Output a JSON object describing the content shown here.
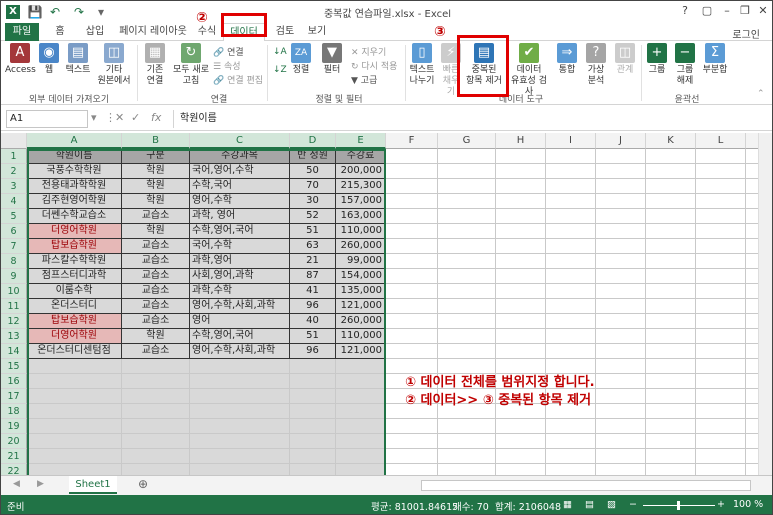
{
  "window": {
    "title": "중복값 연습파일.xlsx - Excel",
    "help": "?",
    "login": "로그인"
  },
  "tabs": [
    "파일",
    "홈",
    "삽입",
    "페이지 레이아웃",
    "수식",
    "데이터",
    "검토",
    "보기"
  ],
  "active_tab": "데이터",
  "ribbon": {
    "ext_group": {
      "label": "외부 데이터 가져오기",
      "buttons": [
        "Access",
        "웹",
        "텍스트",
        "기타",
        "원본에서"
      ]
    },
    "conn_group": {
      "label": "연결",
      "existing": [
        "기존",
        "연결"
      ],
      "refresh_all": [
        "모두 새로",
        "고침"
      ],
      "small": [
        "연결",
        "속성",
        "연결 편집"
      ]
    },
    "sort_group": {
      "label": "정렬 및 필터",
      "sort": "정렬",
      "filter": "필터",
      "small": [
        "지우기",
        "다시 적용",
        "고급"
      ]
    },
    "tools_group": {
      "label": "데이터 도구",
      "text_to_columns": [
        "텍스트",
        "나누기"
      ],
      "flash_fill": [
        "빠른",
        "채우기"
      ],
      "remove_dup": [
        "중복된",
        "항목 제거"
      ],
      "validation": [
        "데이터",
        "유효성 검사"
      ],
      "consolidate": "통합",
      "what_if": [
        "가상",
        "분석"
      ],
      "relations": "관계"
    },
    "outline_group": {
      "label": "윤곽선",
      "group": "그룹",
      "ungroup": [
        "그룹",
        "해제"
      ],
      "subtotal": "부분합"
    }
  },
  "formula_bar": {
    "name_box": "A1",
    "content": "학원이름"
  },
  "columns": [
    "A",
    "B",
    "C",
    "D",
    "E",
    "F",
    "G",
    "H",
    "I",
    "J",
    "K",
    "L",
    "M"
  ],
  "table": {
    "headers": [
      "학원이름",
      "구분",
      "수강과목",
      "반 정원",
      "수강료"
    ],
    "rows": [
      [
        "국풍수학학원",
        "학원",
        "국어,영어,수학",
        "50",
        "200,000"
      ],
      [
        "전용태과학학원",
        "학원",
        "수학,국어",
        "70",
        "215,300"
      ],
      [
        "김주현영어학원",
        "학원",
        "영어,수학",
        "30",
        "157,000"
      ],
      [
        "더쎈수학교습소",
        "교습소",
        "과학, 영어",
        "52",
        "163,000"
      ],
      [
        "더영어학원",
        "학원",
        "수학,영어,국어",
        "51",
        "110,000"
      ],
      [
        "탑보습학원",
        "교습소",
        "국어,수학",
        "63",
        "260,000"
      ],
      [
        "파스칼수학학원",
        "교습소",
        "과학,영어",
        "21",
        "99,000"
      ],
      [
        "점프스터디과학",
        "교습소",
        "사회,영어,과학",
        "87",
        "154,000"
      ],
      [
        "이룸수학",
        "교습소",
        "과학,수학",
        "41",
        "135,000"
      ],
      [
        "온더스터디",
        "교습소",
        "영어,수학,사회,과학",
        "96",
        "121,000"
      ],
      [
        "탑보습학원",
        "교습소",
        "영어",
        "40",
        "260,000"
      ],
      [
        "더영어학원",
        "학원",
        "수학,영어,국어",
        "51",
        "110,000"
      ],
      [
        "온더스터디센텀점",
        "교습소",
        "영어,수학,사회,과학",
        "96",
        "121,000"
      ]
    ],
    "duplicate_rows": [
      5,
      6,
      11,
      12
    ]
  },
  "row_numbers": [
    "1",
    "2",
    "3",
    "4",
    "5",
    "6",
    "7",
    "8",
    "9",
    "10",
    "11",
    "12",
    "13",
    "14",
    "15",
    "16",
    "17",
    "18",
    "19",
    "20",
    "21",
    "22"
  ],
  "annotations": {
    "step1": "① 데이터 전체를 범위지정 합니다.",
    "step2": "② 데이터>> ③ 중복된 항목 제거",
    "marker2": "②",
    "marker3": "③"
  },
  "sheet_tabs": [
    "Sheet1"
  ],
  "status": {
    "mode": "준비",
    "average": "평균: 81001.84615",
    "count": "개수: 70",
    "sum": "합계: 2106048",
    "zoom": "100 %"
  },
  "colors": {
    "excel_green": "#217346",
    "header_fill": "#a6a6a6",
    "data_fill": "#d9d9d9",
    "dup_fill": "#e6b8b7",
    "dup_text": "#9c0006",
    "annotation": "#c00000"
  }
}
